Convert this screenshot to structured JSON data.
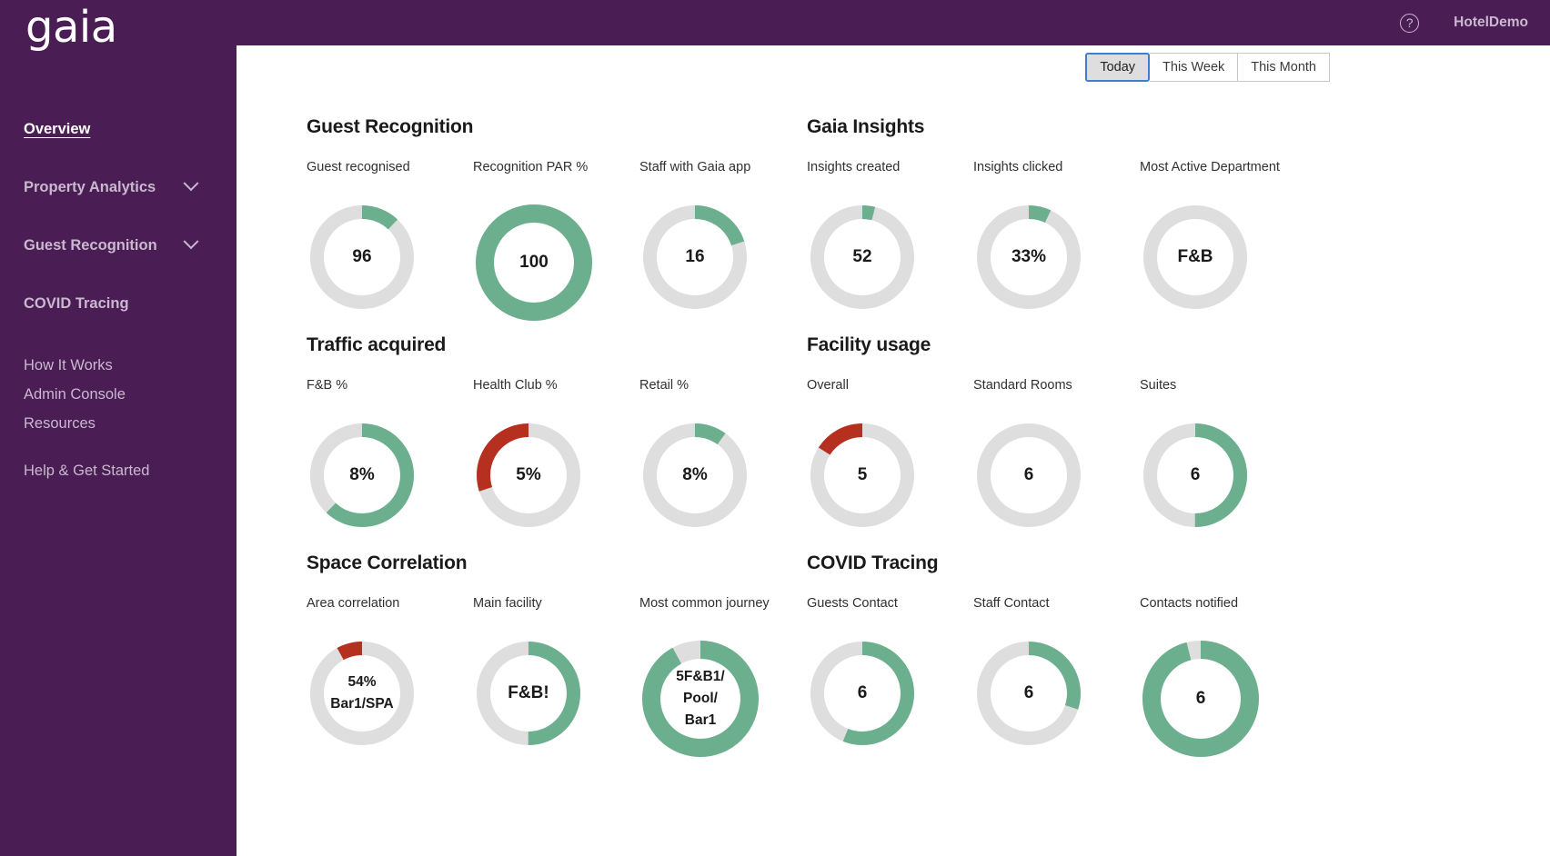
{
  "brand": {
    "logo_text": "gaia"
  },
  "topbar": {
    "help_icon": "help-circle-icon",
    "account_name": "HotelDemo"
  },
  "sidebar": {
    "items": [
      {
        "label": "Overview",
        "type": "primary",
        "active": true,
        "chevron": false
      },
      {
        "label": "Property Analytics",
        "type": "primary",
        "active": false,
        "chevron": true
      },
      {
        "label": "Guest Recognition",
        "type": "primary",
        "active": false,
        "chevron": true
      },
      {
        "label": "COVID Tracing",
        "type": "primary",
        "active": false,
        "chevron": false
      },
      {
        "label": "How It Works",
        "type": "secondary",
        "active": false,
        "chevron": false
      },
      {
        "label": "Admin Console",
        "type": "secondary",
        "active": false,
        "chevron": false
      },
      {
        "label": "Resources",
        "type": "secondary",
        "active": false,
        "chevron": false
      },
      {
        "label": "Help & Get Started",
        "type": "secondary",
        "active": false,
        "chevron": false
      }
    ]
  },
  "range_selector": {
    "options": [
      {
        "label": "Today",
        "selected": true
      },
      {
        "label": "This Week",
        "selected": false
      },
      {
        "label": "This Month",
        "selected": false
      }
    ]
  },
  "colors": {
    "sidebar_purple": "#4A1D55",
    "green": "#6CAF8E",
    "red": "#B5301F",
    "track_grey": "#DEDEDE",
    "accent_blue": "#3F7FD0"
  },
  "chart_data": [
    {
      "type": "pie",
      "title": "Guest Recognition",
      "position": "top-left",
      "metrics": [
        {
          "label": "Guest recognised",
          "value": "96",
          "percent": 12,
          "color": "#6CAF8E",
          "size": "normal",
          "direction": "cw",
          "start": 0
        },
        {
          "label": "Recognition PAR %",
          "value": "100",
          "percent": 100,
          "color": "#6CAF8E",
          "size": "large",
          "direction": "cw",
          "start": 0
        },
        {
          "label": "Staff with Gaia app",
          "value": "16",
          "percent": 20,
          "color": "#6CAF8E",
          "size": "normal",
          "direction": "cw",
          "start": 0
        }
      ]
    },
    {
      "type": "pie",
      "title": "Gaia Insights",
      "position": "top-right",
      "metrics": [
        {
          "label": "Insights created",
          "value": "52",
          "percent": 4,
          "color": "#6CAF8E",
          "size": "normal",
          "direction": "cw",
          "start": 0
        },
        {
          "label": "Insights clicked",
          "value": "33%",
          "percent": 7,
          "color": "#6CAF8E",
          "size": "normal",
          "direction": "cw",
          "start": 0
        },
        {
          "label": "Most Active Department",
          "value": "F&B",
          "percent": 0,
          "color": "#6CAF8E",
          "size": "normal",
          "direction": "cw",
          "start": 0
        }
      ]
    },
    {
      "type": "pie",
      "title": "Traffic acquired",
      "position": "mid-left",
      "metrics": [
        {
          "label": "F&B %",
          "value": "8%",
          "percent": 62,
          "color": "#6CAF8E",
          "size": "normal",
          "direction": "cw",
          "start": 0
        },
        {
          "label": "Health Club %",
          "value": "5%",
          "percent": 30,
          "color": "#B5301F",
          "size": "normal",
          "direction": "ccw",
          "start": 0
        },
        {
          "label": "Retail %",
          "value": "8%",
          "percent": 10,
          "color": "#6CAF8E",
          "size": "normal",
          "direction": "cw",
          "start": 0
        }
      ]
    },
    {
      "type": "pie",
      "title": "Facility usage",
      "position": "mid-right",
      "metrics": [
        {
          "label": "Overall",
          "value": "5",
          "percent": 16,
          "color": "#B5301F",
          "size": "normal",
          "direction": "ccw",
          "start": 0
        },
        {
          "label": "Standard Rooms",
          "value": "6",
          "percent": 0,
          "color": "#6CAF8E",
          "size": "normal",
          "direction": "cw",
          "start": 0
        },
        {
          "label": "Suites",
          "value": "6",
          "percent": 50,
          "color": "#6CAF8E",
          "size": "normal",
          "direction": "cw",
          "start": 0
        }
      ]
    },
    {
      "type": "pie",
      "title": "Space Correlation",
      "position": "bot-left",
      "metrics": [
        {
          "label": "Area correlation",
          "value": "54%\nBar1/SPA",
          "percent": 8,
          "color": "#B5301F",
          "size": "normal",
          "direction": "ccw",
          "start": 0
        },
        {
          "label": "Main facility",
          "value": "F&B!",
          "percent": 50,
          "color": "#6CAF8E",
          "size": "normal",
          "direction": "cw",
          "start": 0
        },
        {
          "label": "Most common journey",
          "value": "5F&B1/\nPool/\nBar1",
          "percent": 92,
          "color": "#6CAF8E",
          "size": "large",
          "direction": "cw",
          "start": 0
        }
      ]
    },
    {
      "type": "pie",
      "title": "COVID Tracing",
      "position": "bot-right",
      "metrics": [
        {
          "label": "Guests Contact",
          "value": "6",
          "percent": 56,
          "color": "#6CAF8E",
          "size": "normal",
          "direction": "cw",
          "start": 0
        },
        {
          "label": "Staff Contact",
          "value": "6",
          "percent": 30,
          "color": "#6CAF8E",
          "size": "normal",
          "direction": "cw",
          "start": 0
        },
        {
          "label": "Contacts notified",
          "value": "6",
          "percent": 96,
          "color": "#6CAF8E",
          "size": "large",
          "direction": "cw",
          "start": 0
        }
      ]
    }
  ]
}
